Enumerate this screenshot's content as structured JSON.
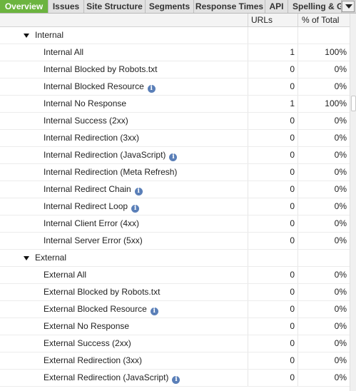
{
  "tabs": [
    {
      "label": "Overview",
      "active": true
    },
    {
      "label": "Issues",
      "active": false
    },
    {
      "label": "Site Structure",
      "active": false
    },
    {
      "label": "Segments",
      "active": false
    },
    {
      "label": "Response Times",
      "active": false
    },
    {
      "label": "API",
      "active": false
    },
    {
      "label": "Spelling & G",
      "active": false
    }
  ],
  "columns": {
    "name": "",
    "urls": "URLs",
    "percent": "% of Total"
  },
  "rows": [
    {
      "type": "group",
      "label": "Internal"
    },
    {
      "type": "item",
      "label": "Internal All",
      "urls": "1",
      "percent": "100%",
      "info": false
    },
    {
      "type": "item",
      "label": "Internal Blocked by Robots.txt",
      "urls": "0",
      "percent": "0%",
      "info": false
    },
    {
      "type": "item",
      "label": "Internal Blocked Resource",
      "urls": "0",
      "percent": "0%",
      "info": true
    },
    {
      "type": "item",
      "label": "Internal No Response",
      "urls": "1",
      "percent": "100%",
      "info": false
    },
    {
      "type": "item",
      "label": "Internal Success (2xx)",
      "urls": "0",
      "percent": "0%",
      "info": false
    },
    {
      "type": "item",
      "label": "Internal Redirection (3xx)",
      "urls": "0",
      "percent": "0%",
      "info": false
    },
    {
      "type": "item",
      "label": "Internal Redirection (JavaScript)",
      "urls": "0",
      "percent": "0%",
      "info": true
    },
    {
      "type": "item",
      "label": "Internal Redirection (Meta Refresh)",
      "urls": "0",
      "percent": "0%",
      "info": false
    },
    {
      "type": "item",
      "label": "Internal Redirect Chain",
      "urls": "0",
      "percent": "0%",
      "info": true
    },
    {
      "type": "item",
      "label": "Internal Redirect Loop",
      "urls": "0",
      "percent": "0%",
      "info": true
    },
    {
      "type": "item",
      "label": "Internal Client Error (4xx)",
      "urls": "0",
      "percent": "0%",
      "info": false
    },
    {
      "type": "item",
      "label": "Internal Server Error (5xx)",
      "urls": "0",
      "percent": "0%",
      "info": false
    },
    {
      "type": "group",
      "label": "External"
    },
    {
      "type": "item",
      "label": "External All",
      "urls": "0",
      "percent": "0%",
      "info": false
    },
    {
      "type": "item",
      "label": "External Blocked by Robots.txt",
      "urls": "0",
      "percent": "0%",
      "info": false
    },
    {
      "type": "item",
      "label": "External Blocked Resource",
      "urls": "0",
      "percent": "0%",
      "info": true
    },
    {
      "type": "item",
      "label": "External No Response",
      "urls": "0",
      "percent": "0%",
      "info": false
    },
    {
      "type": "item",
      "label": "External Success (2xx)",
      "urls": "0",
      "percent": "0%",
      "info": false
    },
    {
      "type": "item",
      "label": "External Redirection (3xx)",
      "urls": "0",
      "percent": "0%",
      "info": false
    },
    {
      "type": "item",
      "label": "External Redirection (JavaScript)",
      "urls": "0",
      "percent": "0%",
      "info": true
    }
  ],
  "info_glyph": "i",
  "colors": {
    "active_tab": "#6cb43f",
    "info_icon": "#5a7fb8"
  }
}
